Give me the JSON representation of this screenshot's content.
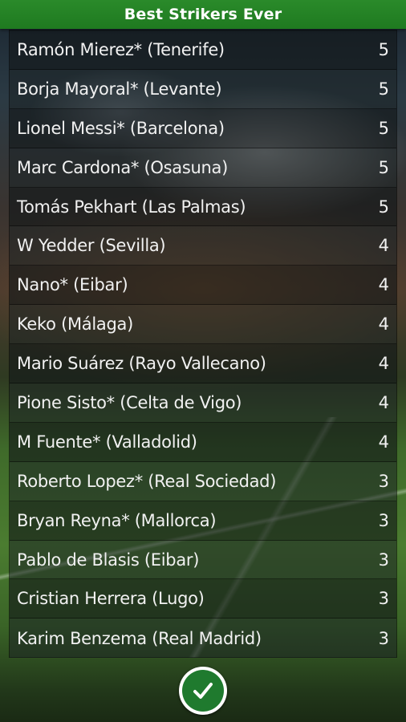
{
  "header": {
    "title": "Best Strikers Ever"
  },
  "strikers": [
    {
      "name": "Ramón Mierez* (Tenerife)",
      "goals": "5"
    },
    {
      "name": "Borja Mayoral* (Levante)",
      "goals": "5"
    },
    {
      "name": "Lionel Messi* (Barcelona)",
      "goals": "5"
    },
    {
      "name": "Marc Cardona* (Osasuna)",
      "goals": "5"
    },
    {
      "name": "Tomás Pekhart (Las Palmas)",
      "goals": "5"
    },
    {
      "name": "W Yedder (Sevilla)",
      "goals": "4"
    },
    {
      "name": "Nano* (Eibar)",
      "goals": "4"
    },
    {
      "name": "Keko (Málaga)",
      "goals": "4"
    },
    {
      "name": "Mario Suárez (Rayo Vallecano)",
      "goals": "4"
    },
    {
      "name": "Pione Sisto* (Celta de Vigo)",
      "goals": "4"
    },
    {
      "name": "M Fuente* (Valladolid)",
      "goals": "4"
    },
    {
      "name": "Roberto Lopez* (Real Sociedad)",
      "goals": "3"
    },
    {
      "name": "Bryan Reyna* (Mallorca)",
      "goals": "3"
    },
    {
      "name": "Pablo de Blasis (Eibar)",
      "goals": "3"
    },
    {
      "name": "Cristian Herrera (Lugo)",
      "goals": "3"
    },
    {
      "name": "Karim Benzema (Real Madrid)",
      "goals": "3"
    }
  ],
  "confirm_button": {
    "icon": "checkmark-icon"
  },
  "colors": {
    "header_green": "#1f7a20",
    "button_green": "#1f7a2e",
    "text": "#f1f1f1"
  }
}
